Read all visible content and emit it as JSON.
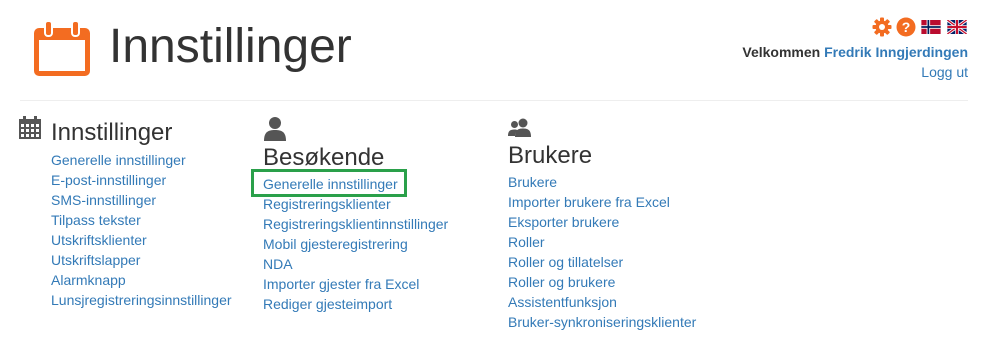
{
  "header": {
    "title": "Innstillinger",
    "welcome_label": "Velkommen",
    "user_name": "Fredrik Inngjerdingen",
    "logout": "Logg ut",
    "icons": [
      "calendar-icon",
      "gear-icon",
      "help-icon",
      "norway-flag-icon",
      "uk-flag-icon"
    ]
  },
  "colors": {
    "accent_orange": "#f36c21",
    "link": "#337ab7",
    "highlight": "#2aa04a"
  },
  "sections": {
    "settings": {
      "title": "Innstillinger",
      "icon": "calendar-grid-icon",
      "links": [
        "Generelle innstillinger",
        "E-post-innstillinger",
        "SMS-innstillinger",
        "Tilpass tekster",
        "Utskriftsklienter",
        "Utskriftslapper",
        "Alarmknapp",
        "Lunsjregistreringsinnstillinger"
      ]
    },
    "visitors": {
      "title": "Besøkende",
      "icon": "user-icon",
      "links": [
        "Generelle innstillinger",
        "Registreringsklienter",
        "Registreringsklientinnstillinger",
        "Mobil gjesteregistrering",
        "NDA",
        "Importer gjester fra Excel",
        "Rediger gjesteimport"
      ]
    },
    "users": {
      "title": "Brukere",
      "icon": "users-icon",
      "links": [
        "Brukere",
        "Importer brukere fra Excel",
        "Eksporter brukere",
        "Roller",
        "Roller og tillatelser",
        "Roller og brukere",
        "Assistentfunksjon",
        "Bruker-synkroniseringsklienter"
      ]
    }
  }
}
